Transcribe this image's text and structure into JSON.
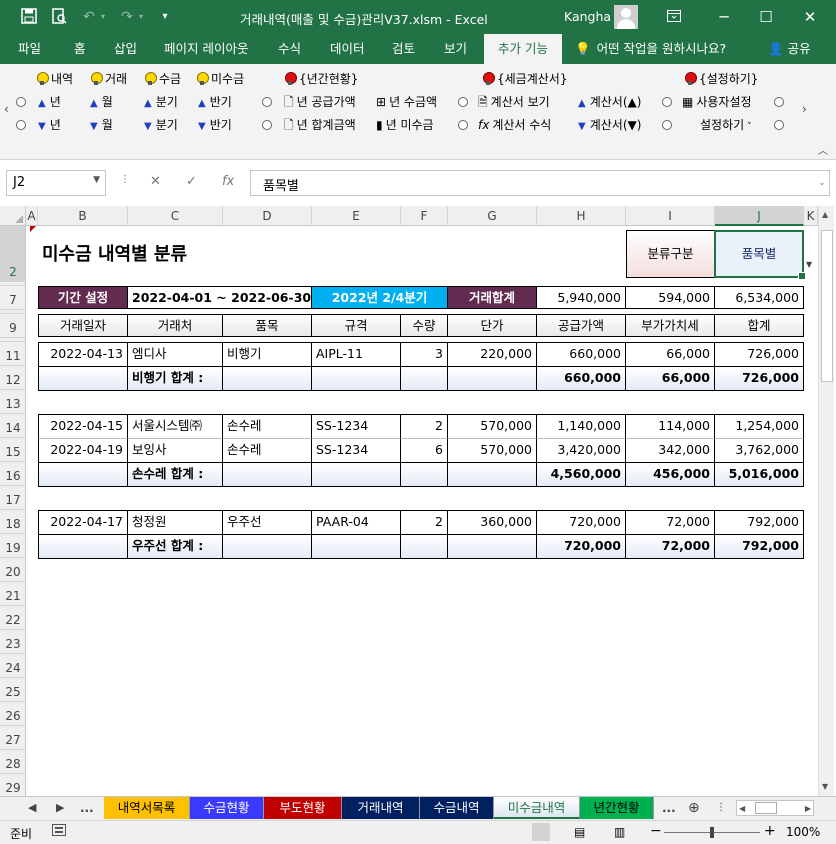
{
  "titlebar": {
    "title": "거래내역(매출 및 수금)관리V37.xlsm  -  Excel",
    "user": "Kangha",
    "save_icon": "save-icon",
    "minimize": "─",
    "restore": "☐",
    "close": "✕"
  },
  "tabs": [
    "파일",
    "홈",
    "삽입",
    "페이지 레이아웃",
    "수식",
    "데이터",
    "검토",
    "보기",
    "추가 기능"
  ],
  "active_tab": "추가 기능",
  "tell_me": "어떤 작업을 원하시나요?",
  "share": "공유",
  "ribbon": {
    "group1": [
      "내역",
      "거래",
      "수금",
      "미수금"
    ],
    "row_up": [
      "년",
      "월",
      "분기",
      "반기"
    ],
    "row_down": [
      "년",
      "월",
      "분기",
      "반기"
    ],
    "annual_title": "{년간현황}",
    "annual_up": "년 공급가액",
    "annual_up2": "년 수금액",
    "annual_down": "년 합계금액",
    "annual_down2": "년 미수금",
    "tax_title": "{세금계산서}",
    "tax_up": "계산서 보기",
    "tax_up2": "계산서(▲)",
    "tax_down": "계산서 수식",
    "tax_down2": "계산서(▼)",
    "settings_title": "{설정하기}",
    "settings_up": "사용자설정",
    "settings_down": "설정하기"
  },
  "formula_bar": {
    "name_box": "J2",
    "formula": "품목별"
  },
  "columns": [
    "A",
    "B",
    "C",
    "D",
    "E",
    "F",
    "G",
    "H",
    "I",
    "J",
    "K"
  ],
  "rows": [
    "2",
    "7",
    "9",
    "11",
    "12",
    "13",
    "14",
    "15",
    "16",
    "17",
    "18",
    "19",
    "20",
    "21",
    "22",
    "23",
    "24",
    "25",
    "26",
    "27",
    "28",
    "29"
  ],
  "sheet": {
    "title": "미수금 내역별 분류",
    "classify_label": "분류구분",
    "classify_value": "품목별",
    "period_label": "기간 설정",
    "period_range": "2022-04-01  ~  2022-06-30",
    "period_quarter": "2022년 2/4분기",
    "total_label": "거래합계",
    "total_supply": "5,940,000",
    "total_vat": "594,000",
    "total_sum": "6,534,000",
    "headers": [
      "거래일자",
      "거래처",
      "품목",
      "규격",
      "수량",
      "단가",
      "공급가액",
      "부가가치세",
      "합계"
    ],
    "groups": [
      {
        "rows": [
          {
            "date": "2022-04-13",
            "client": "엠디사",
            "item": "비행기",
            "spec": "AIPL-11",
            "qty": "3",
            "price": "220,000",
            "supply": "660,000",
            "vat": "66,000",
            "sum": "726,000"
          }
        ],
        "subtotal": {
          "label": "비행기 합계  :",
          "supply": "660,000",
          "vat": "66,000",
          "sum": "726,000"
        }
      },
      {
        "rows": [
          {
            "date": "2022-04-15",
            "client": "서울시스템㈜",
            "item": "손수레",
            "spec": "SS-1234",
            "qty": "2",
            "price": "570,000",
            "supply": "1,140,000",
            "vat": "114,000",
            "sum": "1,254,000"
          },
          {
            "date": "2022-04-19",
            "client": "보잉사",
            "item": "손수레",
            "spec": "SS-1234",
            "qty": "6",
            "price": "570,000",
            "supply": "3,420,000",
            "vat": "342,000",
            "sum": "3,762,000"
          }
        ],
        "subtotal": {
          "label": "손수레 합계  :",
          "supply": "4,560,000",
          "vat": "456,000",
          "sum": "5,016,000"
        }
      },
      {
        "rows": [
          {
            "date": "2022-04-17",
            "client": "청정원",
            "item": "우주선",
            "spec": "PAAR-04",
            "qty": "2",
            "price": "360,000",
            "supply": "720,000",
            "vat": "72,000",
            "sum": "792,000"
          }
        ],
        "subtotal": {
          "label": "우주선 합계  :",
          "supply": "720,000",
          "vat": "72,000",
          "sum": "792,000"
        }
      }
    ]
  },
  "sheet_tabs": [
    {
      "label": "내역서목록",
      "bg": "#ffc000",
      "fg": "#000000"
    },
    {
      "label": "수금현황",
      "bg": "#3a3aff",
      "fg": "#ffffff"
    },
    {
      "label": "부도현황",
      "bg": "#c00000",
      "fg": "#ffffff"
    },
    {
      "label": "거래내역",
      "bg": "#002060",
      "fg": "#ffffff"
    },
    {
      "label": "수금내역",
      "bg": "#002060",
      "fg": "#ffffff"
    },
    {
      "label": "미수금내역",
      "bg": "#dce6f0",
      "fg": "#217346"
    },
    {
      "label": "년간현황",
      "bg": "#00b050",
      "fg": "#000000"
    }
  ],
  "status": {
    "ready": "준비",
    "zoom": "100%"
  },
  "colors": {
    "excel_green": "#217346",
    "label_maroon": "#632b4f",
    "quarter_cyan": "#00b0f0",
    "subtotal_bg": "#e8eef7"
  }
}
